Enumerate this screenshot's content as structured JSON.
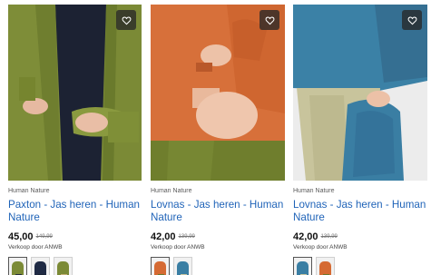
{
  "products": [
    {
      "brand": "Human Nature",
      "title": "Paxton - Jas heren - Human Nature",
      "price": "45,00",
      "old_price": "149,99",
      "seller": "Verkoop door ANWB",
      "favorite_icon": "heart-icon",
      "jacket_color": "#7b8a36",
      "swatches": [
        {
          "color": "#7b8a36",
          "pants": "#2a2f3f",
          "selected": true
        },
        {
          "color": "#1f2a44",
          "pants": "#1a2233",
          "selected": false
        },
        {
          "color": "#7b8a36",
          "pants": "#c7b27a",
          "selected": false
        }
      ]
    },
    {
      "brand": "Human Nature",
      "title": "Lovnas - Jas heren - Human Nature",
      "price": "42,00",
      "old_price": "139,99",
      "seller": "Verkoop door ANWB",
      "favorite_icon": "heart-icon",
      "jacket_color": "#d56a33",
      "swatches": [
        {
          "color": "#d56a33",
          "pants": "#6b7a2e",
          "selected": true
        },
        {
          "color": "#3a7ea3",
          "pants": "#c9c5a0",
          "selected": false
        }
      ]
    },
    {
      "brand": "Human Nature",
      "title": "Lovnas - Jas heren - Human Nature",
      "price": "42,00",
      "old_price": "139,99",
      "seller": "Verkoop door ANWB",
      "favorite_icon": "heart-icon",
      "jacket_color": "#3a7ea3",
      "swatches": [
        {
          "color": "#3a7ea3",
          "pants": "#c9c5a0",
          "selected": true
        },
        {
          "color": "#d56a33",
          "pants": "#6b7a2e",
          "selected": false
        }
      ]
    }
  ]
}
